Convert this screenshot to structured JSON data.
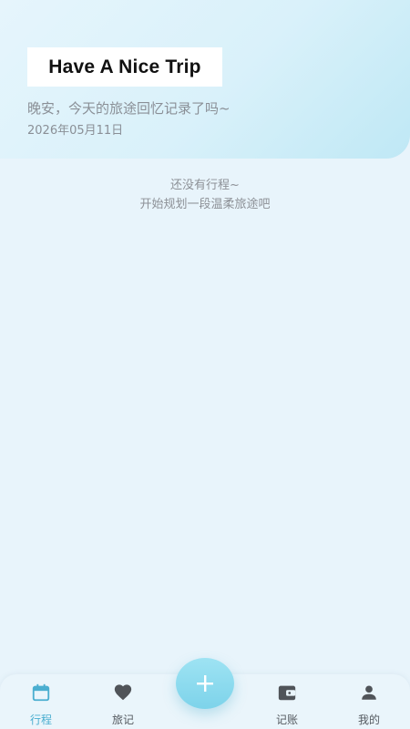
{
  "header": {
    "title": "Have A Nice Trip",
    "greeting": "晚安，今天的旅途回忆记录了吗~",
    "date": "2026年05月11日"
  },
  "empty_state": {
    "line1": "还没有行程~",
    "line2": "开始规划一段温柔旅途吧"
  },
  "tabbar": {
    "tabs": [
      {
        "label": "行程",
        "icon": "calendar-icon",
        "active": true
      },
      {
        "label": "旅记",
        "icon": "heart-icon",
        "active": false
      },
      {
        "label": "记账",
        "icon": "wallet-icon",
        "active": false
      },
      {
        "label": "我的",
        "icon": "user-icon",
        "active": false
      }
    ],
    "fab_icon": "plus-icon"
  },
  "colors": {
    "accent": "#4aaed0",
    "fab": "#8fdcef",
    "background": "#e8f4fb",
    "muted_text": "#8a8f96"
  }
}
